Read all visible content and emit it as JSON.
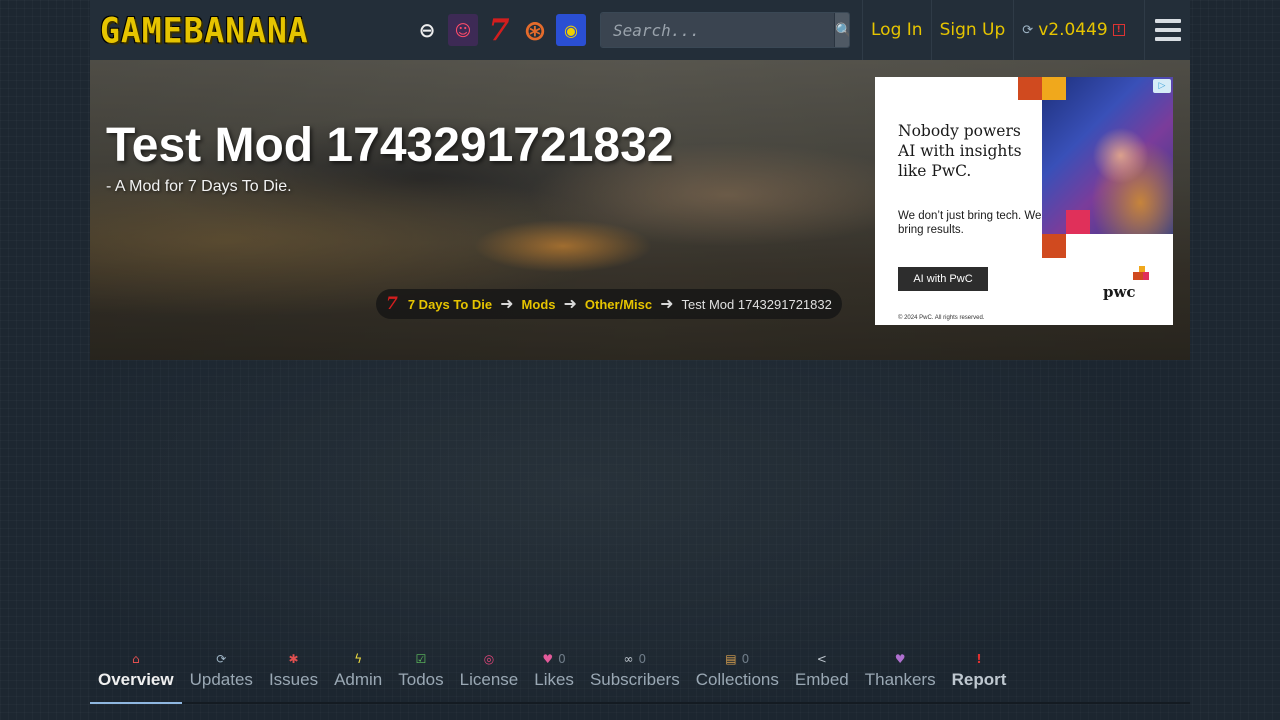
{
  "header": {
    "logo_text": "GAMEBANANA",
    "game_icons": [
      {
        "name": "smash-bros-icon",
        "glyph": "⊖"
      },
      {
        "name": "fnf-icon",
        "glyph": "☺"
      },
      {
        "name": "7-days-to-die-icon",
        "glyph": "7"
      },
      {
        "name": "tf2-icon",
        "glyph": "⊛"
      },
      {
        "name": "sonic-icon",
        "glyph": "◉"
      }
    ],
    "search_placeholder": "Search...",
    "login_label": "Log In",
    "signup_label": "Sign Up",
    "version_label": "v2.0449"
  },
  "banner": {
    "title": "Test Mod 1743291721832",
    "subtitle": "- A Mod for 7 Days To Die.",
    "breadcrumb": {
      "game_icon": "7",
      "game": "7 Days To Die",
      "section": "Mods",
      "category": "Other/Misc",
      "current": "Test Mod 1743291721832"
    }
  },
  "ad": {
    "headline": "Nobody powers AI with insights like PwC.",
    "body": "We don’t just bring tech. We bring results.",
    "cta": "AI with PwC",
    "brand": "pwc",
    "copyright": "© 2024 PwC. All rights reserved."
  },
  "tabs": [
    {
      "name": "tab-overview",
      "icon": "home-icon",
      "glyph": "⌂",
      "icls": "ic-home",
      "label": "Overview",
      "count": "",
      "active": true
    },
    {
      "name": "tab-updates",
      "icon": "updates-icon",
      "glyph": "⟳",
      "icls": "ic-updates",
      "label": "Updates",
      "count": ""
    },
    {
      "name": "tab-issues",
      "icon": "bug-icon",
      "glyph": "✱",
      "icls": "ic-issues",
      "label": "Issues",
      "count": ""
    },
    {
      "name": "tab-admin",
      "icon": "lightning-icon",
      "glyph": "ϟ",
      "icls": "ic-admin",
      "label": "Admin",
      "count": ""
    },
    {
      "name": "tab-todos",
      "icon": "checkbox-icon",
      "glyph": "☑",
      "icls": "ic-todos",
      "label": "Todos",
      "count": ""
    },
    {
      "name": "tab-license",
      "icon": "license-icon",
      "glyph": "◎",
      "icls": "ic-license",
      "label": "License",
      "count": ""
    },
    {
      "name": "tab-likes",
      "icon": "heart-icon",
      "glyph": "♥",
      "icls": "ic-likes",
      "label": "Likes",
      "count": "0"
    },
    {
      "name": "tab-subscribers",
      "icon": "link-icon",
      "glyph": "∞",
      "icls": "ic-subs",
      "label": "Subscribers",
      "count": "0"
    },
    {
      "name": "tab-collections",
      "icon": "collection-icon",
      "glyph": "▤",
      "icls": "ic-coll",
      "label": "Collections",
      "count": "0"
    },
    {
      "name": "tab-embed",
      "icon": "share-icon",
      "glyph": "<",
      "icls": "ic-embed",
      "label": "Embed",
      "count": ""
    },
    {
      "name": "tab-thankers",
      "icon": "thanks-heart-icon",
      "glyph": "♥",
      "icls": "ic-thank",
      "label": "Thankers",
      "count": ""
    },
    {
      "name": "tab-report",
      "icon": "exclamation-icon",
      "glyph": "!",
      "icls": "ic-report",
      "label": "Report",
      "count": ""
    }
  ]
}
